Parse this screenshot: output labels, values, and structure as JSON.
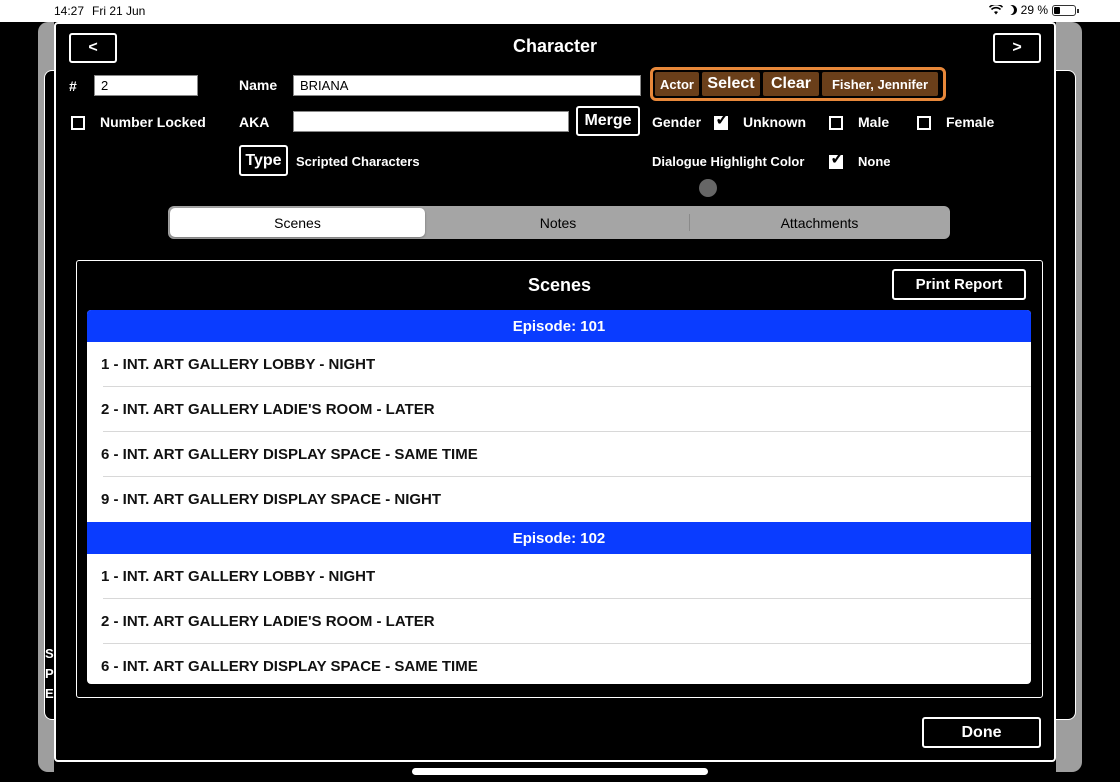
{
  "status": {
    "time": "14:27",
    "date": "Fri 21 Jun",
    "battery": "29 %"
  },
  "background": {
    "letters": [
      "S",
      "P",
      "E"
    ]
  },
  "dialog": {
    "title": "Character",
    "prev_label": "<",
    "next_label": ">",
    "number_label": "#",
    "number_value": "2",
    "name_label": "Name",
    "name_value": "BRIANA",
    "aka_label": "AKA",
    "aka_value": "",
    "merge_label": "Merge",
    "number_locked_label": "Number Locked",
    "type_button": "Type",
    "type_value": "Scripted Characters",
    "actor": {
      "actor_label": "Actor",
      "select_label": "Select",
      "clear_label": "Clear",
      "actor_name": "Fisher, Jennifer",
      "accent": "#e8883a"
    },
    "gender_label": "Gender",
    "gender_options": [
      "Unknown",
      "Male",
      "Female"
    ],
    "gender_selected": "Unknown",
    "dialogue_color_label": "Dialogue Highlight Color",
    "dialogue_color_value": "None",
    "tabs": [
      "Scenes",
      "Notes",
      "Attachments"
    ],
    "active_tab": "Scenes",
    "done_label": "Done"
  },
  "scenes": {
    "title": "Scenes",
    "print_label": "Print Report",
    "episode_color": "#0a3cff",
    "episodes": [
      {
        "label": "Episode: 101",
        "scenes": [
          "1 - INT. ART GALLERY LOBBY - NIGHT",
          "2 - INT. ART GALLERY LADIE'S ROOM - LATER",
          "6 - INT. ART GALLERY DISPLAY SPACE - SAME TIME",
          "9 - INT. ART GALLERY DISPLAY SPACE - NIGHT"
        ]
      },
      {
        "label": "Episode: 102",
        "scenes": [
          "1 - INT. ART GALLERY LOBBY - NIGHT",
          "2 - INT. ART GALLERY LADIE'S ROOM - LATER",
          "6 - INT. ART GALLERY DISPLAY SPACE - SAME TIME"
        ]
      }
    ]
  }
}
